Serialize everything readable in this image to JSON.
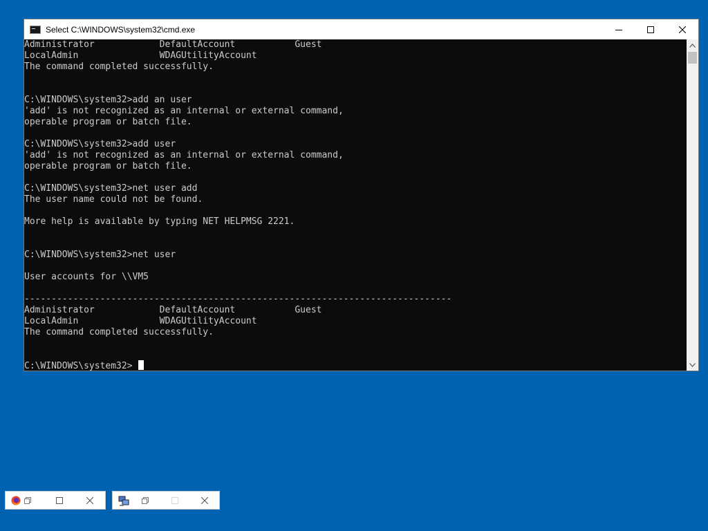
{
  "window": {
    "title": "Select C:\\WINDOWS\\system32\\cmd.exe",
    "icon": "console-icon",
    "buttons": {
      "minimize": "minimize-icon",
      "maximize": "maximize-icon",
      "close": "close-icon"
    }
  },
  "console": {
    "background": "#0c0c0c",
    "foreground": "#cccccc",
    "lines": [
      "Administrator            DefaultAccount           Guest",
      "LocalAdmin               WDAGUtilityAccount",
      "The command completed successfully.",
      "",
      "",
      "C:\\WINDOWS\\system32>add an user",
      "'add' is not recognized as an internal or external command,",
      "operable program or batch file.",
      "",
      "C:\\WINDOWS\\system32>add user",
      "'add' is not recognized as an internal or external command,",
      "operable program or batch file.",
      "",
      "C:\\WINDOWS\\system32>net user add",
      "The user name could not be found.",
      "",
      "More help is available by typing NET HELPMSG 2221.",
      "",
      "",
      "C:\\WINDOWS\\system32>net user",
      "",
      "User accounts for \\\\VM5",
      "",
      "-------------------------------------------------------------------------------",
      "Administrator            DefaultAccount           Guest",
      "LocalAdmin               WDAGUtilityAccount",
      "The command completed successfully.",
      "",
      ""
    ],
    "prompt": "C:\\WINDOWS\\system32> "
  },
  "minimized_windows": [
    {
      "icon": "firefox-icon",
      "buttons": [
        "restore-icon",
        "maximize-icon",
        "close-icon"
      ]
    },
    {
      "icon": "network-computer-icon",
      "buttons": [
        "restore-icon",
        "maximize-icon",
        "close-icon"
      ]
    }
  ],
  "colors": {
    "desktop": "#0063b1",
    "titlebar": "#ffffff",
    "scrollbar": "#f0f0f0"
  }
}
